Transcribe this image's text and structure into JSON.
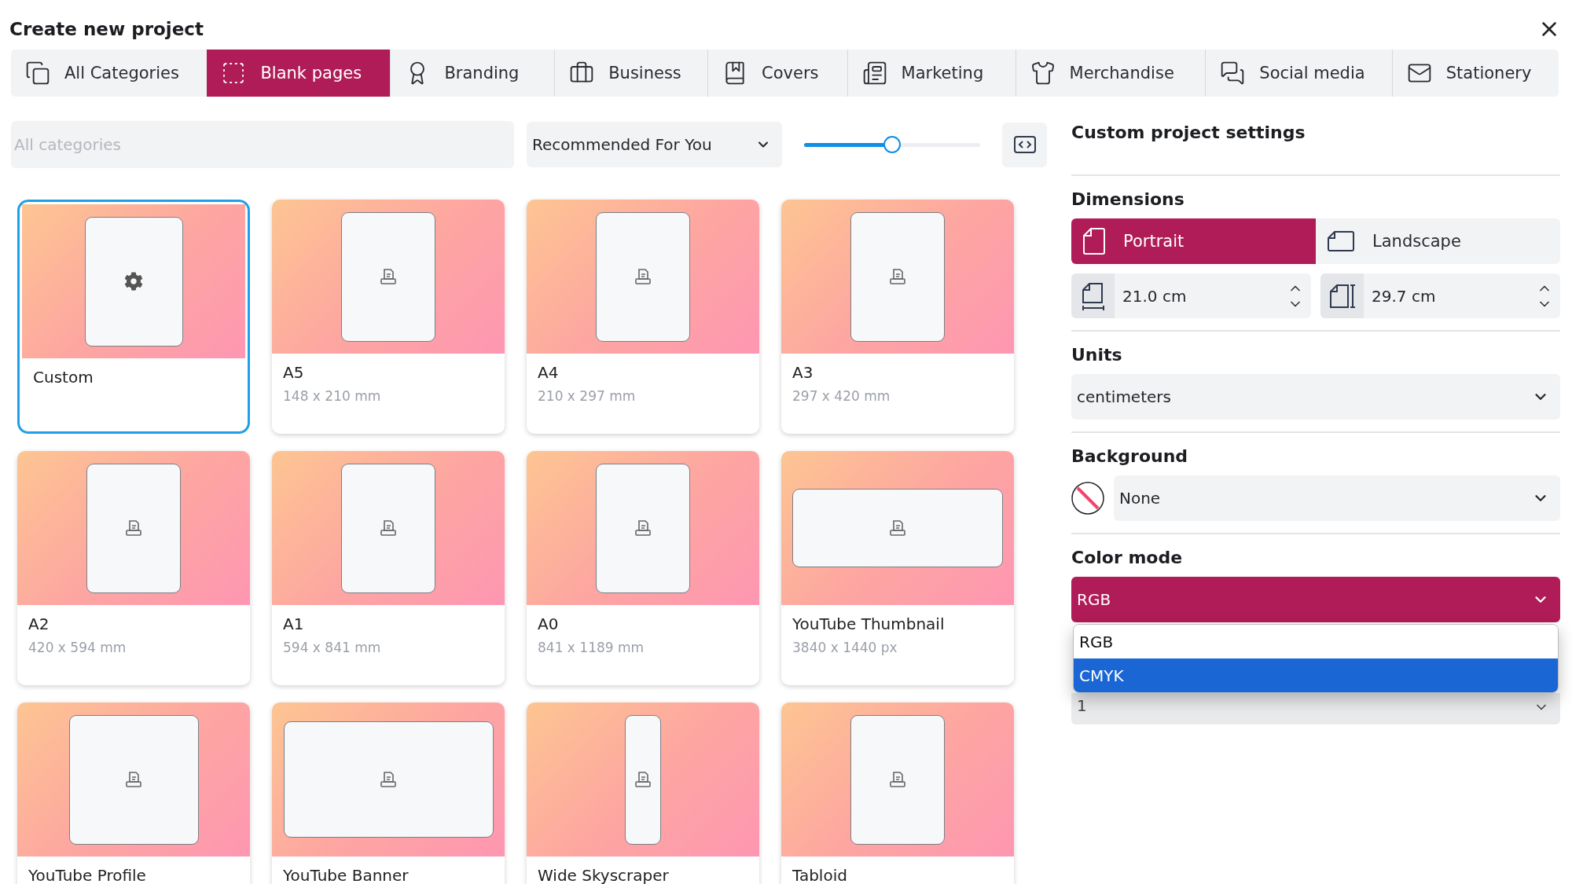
{
  "window": {
    "title": "Create new project"
  },
  "tabs": [
    {
      "label": "All Categories",
      "selected": false
    },
    {
      "label": "Blank pages",
      "selected": true
    },
    {
      "label": "Branding",
      "selected": false
    },
    {
      "label": "Business",
      "selected": false
    },
    {
      "label": "Covers",
      "selected": false
    },
    {
      "label": "Marketing",
      "selected": false
    },
    {
      "label": "Merchandise",
      "selected": false
    },
    {
      "label": "Social media",
      "selected": false
    },
    {
      "label": "Stationery",
      "selected": false
    }
  ],
  "toolbar": {
    "search": {
      "placeholder": "All categories"
    },
    "sort": {
      "value": "Recommended For You"
    },
    "zoom_slider": {
      "level": 0.5
    }
  },
  "templates": [
    {
      "name": "Custom",
      "kind": "custom",
      "selected": true
    },
    {
      "name": "A5",
      "size": "148 x 210 mm",
      "kind": "portrait",
      "selected": false
    },
    {
      "name": "A4",
      "size": "210 x 297 mm",
      "kind": "portrait",
      "selected": false
    },
    {
      "name": "A3",
      "size": "297 x 420 mm",
      "kind": "portrait",
      "selected": false
    },
    {
      "name": "A2",
      "size": "420 x 594 mm",
      "kind": "portrait",
      "selected": false
    },
    {
      "name": "A1",
      "size": "594 x 841 mm",
      "kind": "portrait",
      "selected": false
    },
    {
      "name": "A0",
      "size": "841 x 1189 mm",
      "kind": "portrait",
      "selected": false
    },
    {
      "name": "YouTube Thumbnail",
      "size": "3840 x 1440 px",
      "kind": "wide",
      "selected": false
    },
    {
      "name": "YouTube Profile",
      "kind": "square",
      "selected": false
    },
    {
      "name": "YouTube Banner",
      "kind": "banner",
      "selected": false
    },
    {
      "name": "Wide Skyscraper",
      "kind": "narrow",
      "selected": false
    },
    {
      "name": "Tabloid",
      "kind": "portrait",
      "selected": false
    }
  ],
  "settings": {
    "title": "Custom project settings",
    "dimensions": {
      "label": "Dimensions",
      "orientations": [
        {
          "label": "Portrait",
          "kind": "portrait",
          "selected": true
        },
        {
          "label": "Landscape",
          "kind": "landscape",
          "selected": false
        }
      ],
      "fields": [
        {
          "kind": "width",
          "value": "21.0 cm"
        },
        {
          "kind": "height",
          "value": "29.7 cm"
        }
      ]
    },
    "units": {
      "label": "Units",
      "value": "centimeters"
    },
    "background": {
      "label": "Background",
      "value": "None"
    },
    "color_mode": {
      "label": "Color mode",
      "value": "RGB",
      "open": true,
      "options": [
        {
          "label": "RGB",
          "highlighted": false
        },
        {
          "label": "CMYK",
          "highlighted": true
        }
      ]
    },
    "number_field": {
      "value": "1"
    }
  }
}
